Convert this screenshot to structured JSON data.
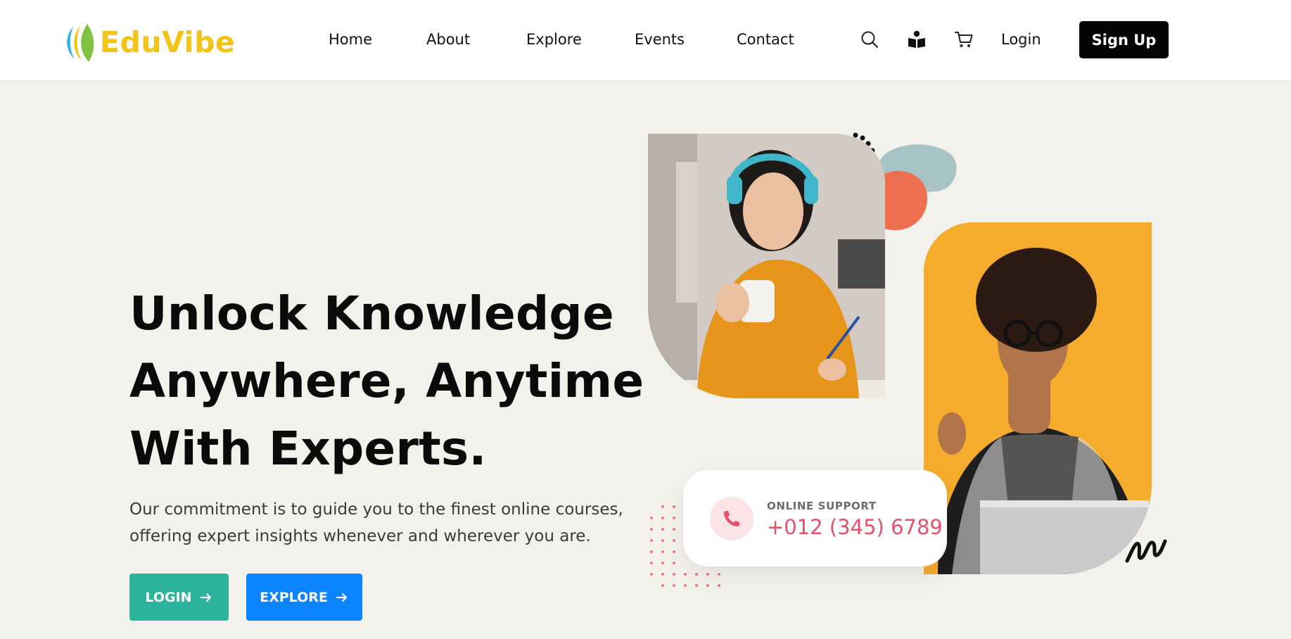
{
  "header": {
    "logo_text": "EduVibe",
    "nav": [
      "Home",
      "About",
      "Explore",
      "Events",
      "Contact"
    ],
    "icons": [
      "search-icon",
      "book-reader-icon",
      "cart-icon"
    ],
    "login_label": "Login",
    "signup_label": "Sign Up"
  },
  "hero": {
    "title_lines": [
      "Unlock Knowledge",
      "Anywhere, Anytime",
      "With Experts."
    ],
    "description_lines": [
      "Our commitment is to guide you to the finest online courses,",
      "offering expert insights whenever and wherever you are."
    ],
    "login_button": "LOGIN",
    "explore_button": "EXPLORE"
  },
  "support": {
    "label": "ONLINE SUPPORT",
    "phone": "+012 (345) 6789"
  },
  "colors": {
    "background": "#f3f1eb",
    "logo": "#f2c41a",
    "login_button": "#2bb39c",
    "explore_button": "#0a84ff",
    "signup_button": "#050505",
    "support_phone": "#e8506a",
    "photo_2_background": "#f5ac2c"
  }
}
